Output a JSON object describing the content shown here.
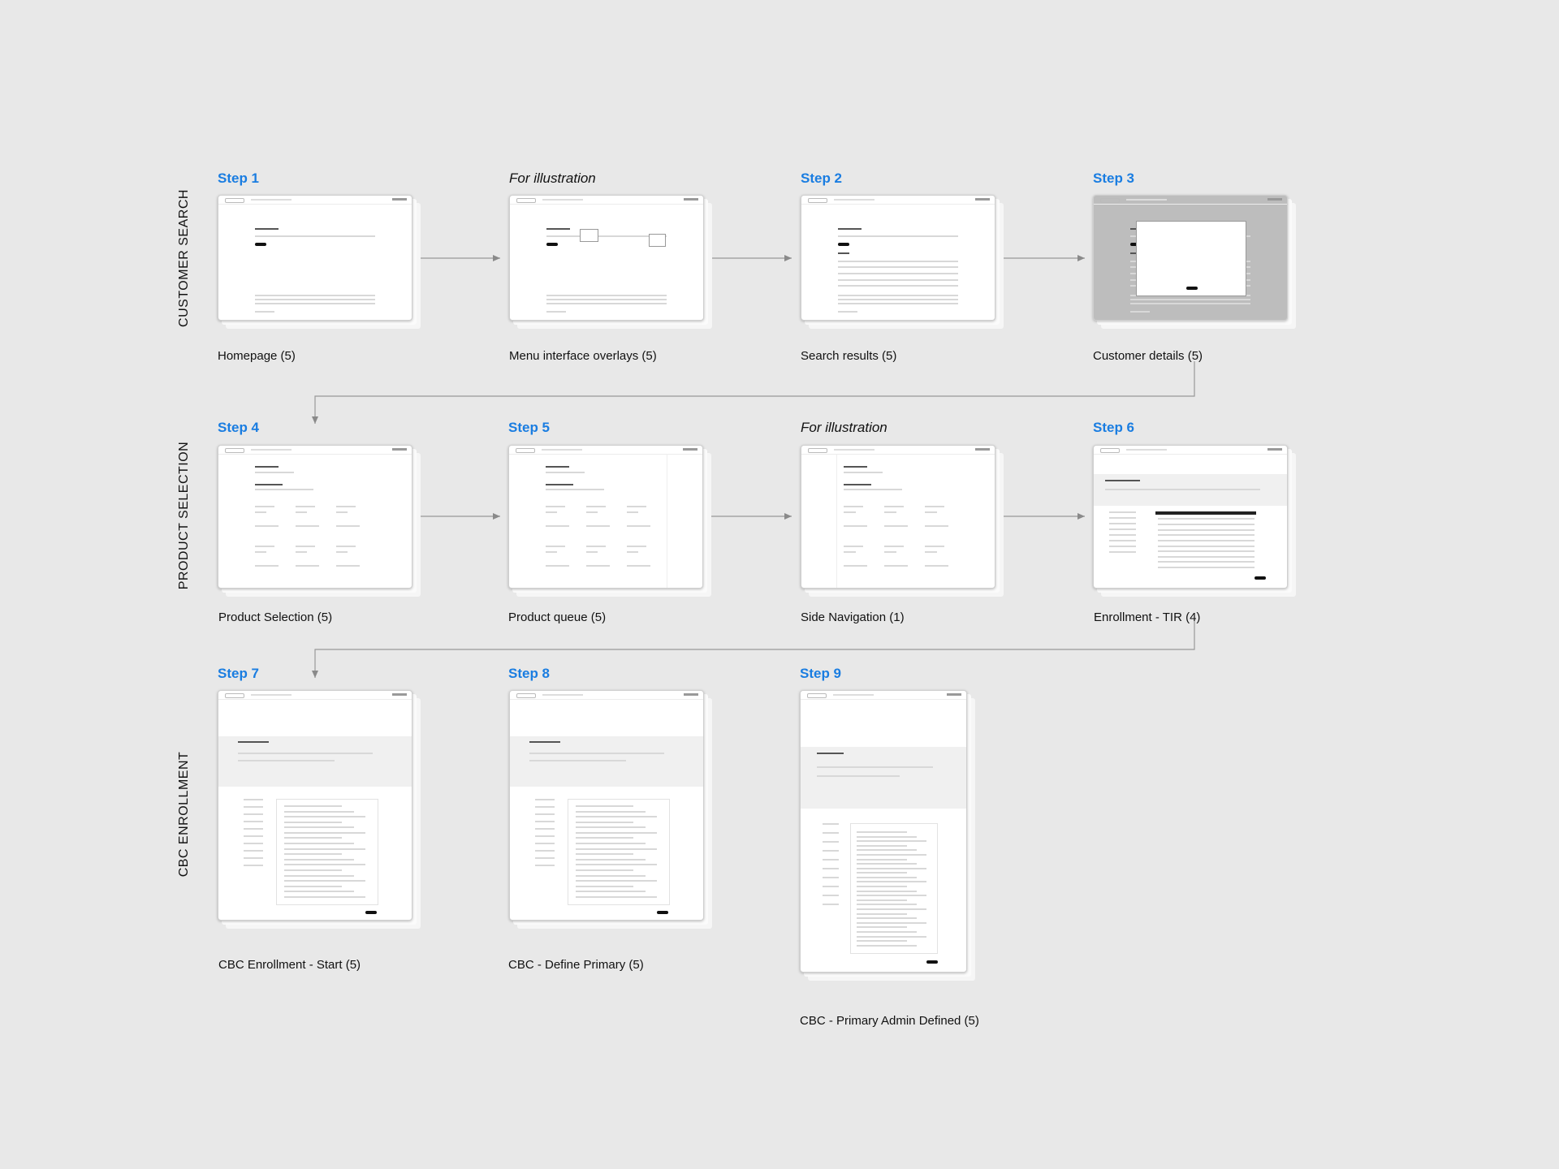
{
  "rows": [
    {
      "label": "CUSTOMER SEARCH"
    },
    {
      "label": "PRODUCT SELECTION"
    },
    {
      "label": "CBC ENROLLMENT"
    }
  ],
  "cards": [
    {
      "step": "Step 1",
      "caption": "Homepage (5)",
      "illustration": false
    },
    {
      "step": "For illustration",
      "caption": "Menu interface overlays (5)",
      "illustration": true
    },
    {
      "step": "Step 2",
      "caption": "Search results (5)",
      "illustration": false
    },
    {
      "step": "Step 3",
      "caption": "Customer details (5)",
      "illustration": false
    },
    {
      "step": "Step 4",
      "caption": "Product Selection (5)",
      "illustration": false
    },
    {
      "step": "Step 5",
      "caption": "Product queue (5)",
      "illustration": false
    },
    {
      "step": "For illustration",
      "caption": "Side Navigation (1)",
      "illustration": true
    },
    {
      "step": "Step 6",
      "caption": "Enrollment - TIR (4)",
      "illustration": false
    },
    {
      "step": "Step 7",
      "caption": "CBC Enrollment - Start (5)",
      "illustration": false
    },
    {
      "step": "Step 8",
      "caption": "CBC - Define Primary (5)",
      "illustration": false
    },
    {
      "step": "Step 9",
      "caption": "CBC - Primary Admin Defined (5)",
      "illustration": false
    }
  ],
  "colors": {
    "step_blue": "#1a7de1",
    "background": "#e8e8e8",
    "connector": "#999999"
  }
}
